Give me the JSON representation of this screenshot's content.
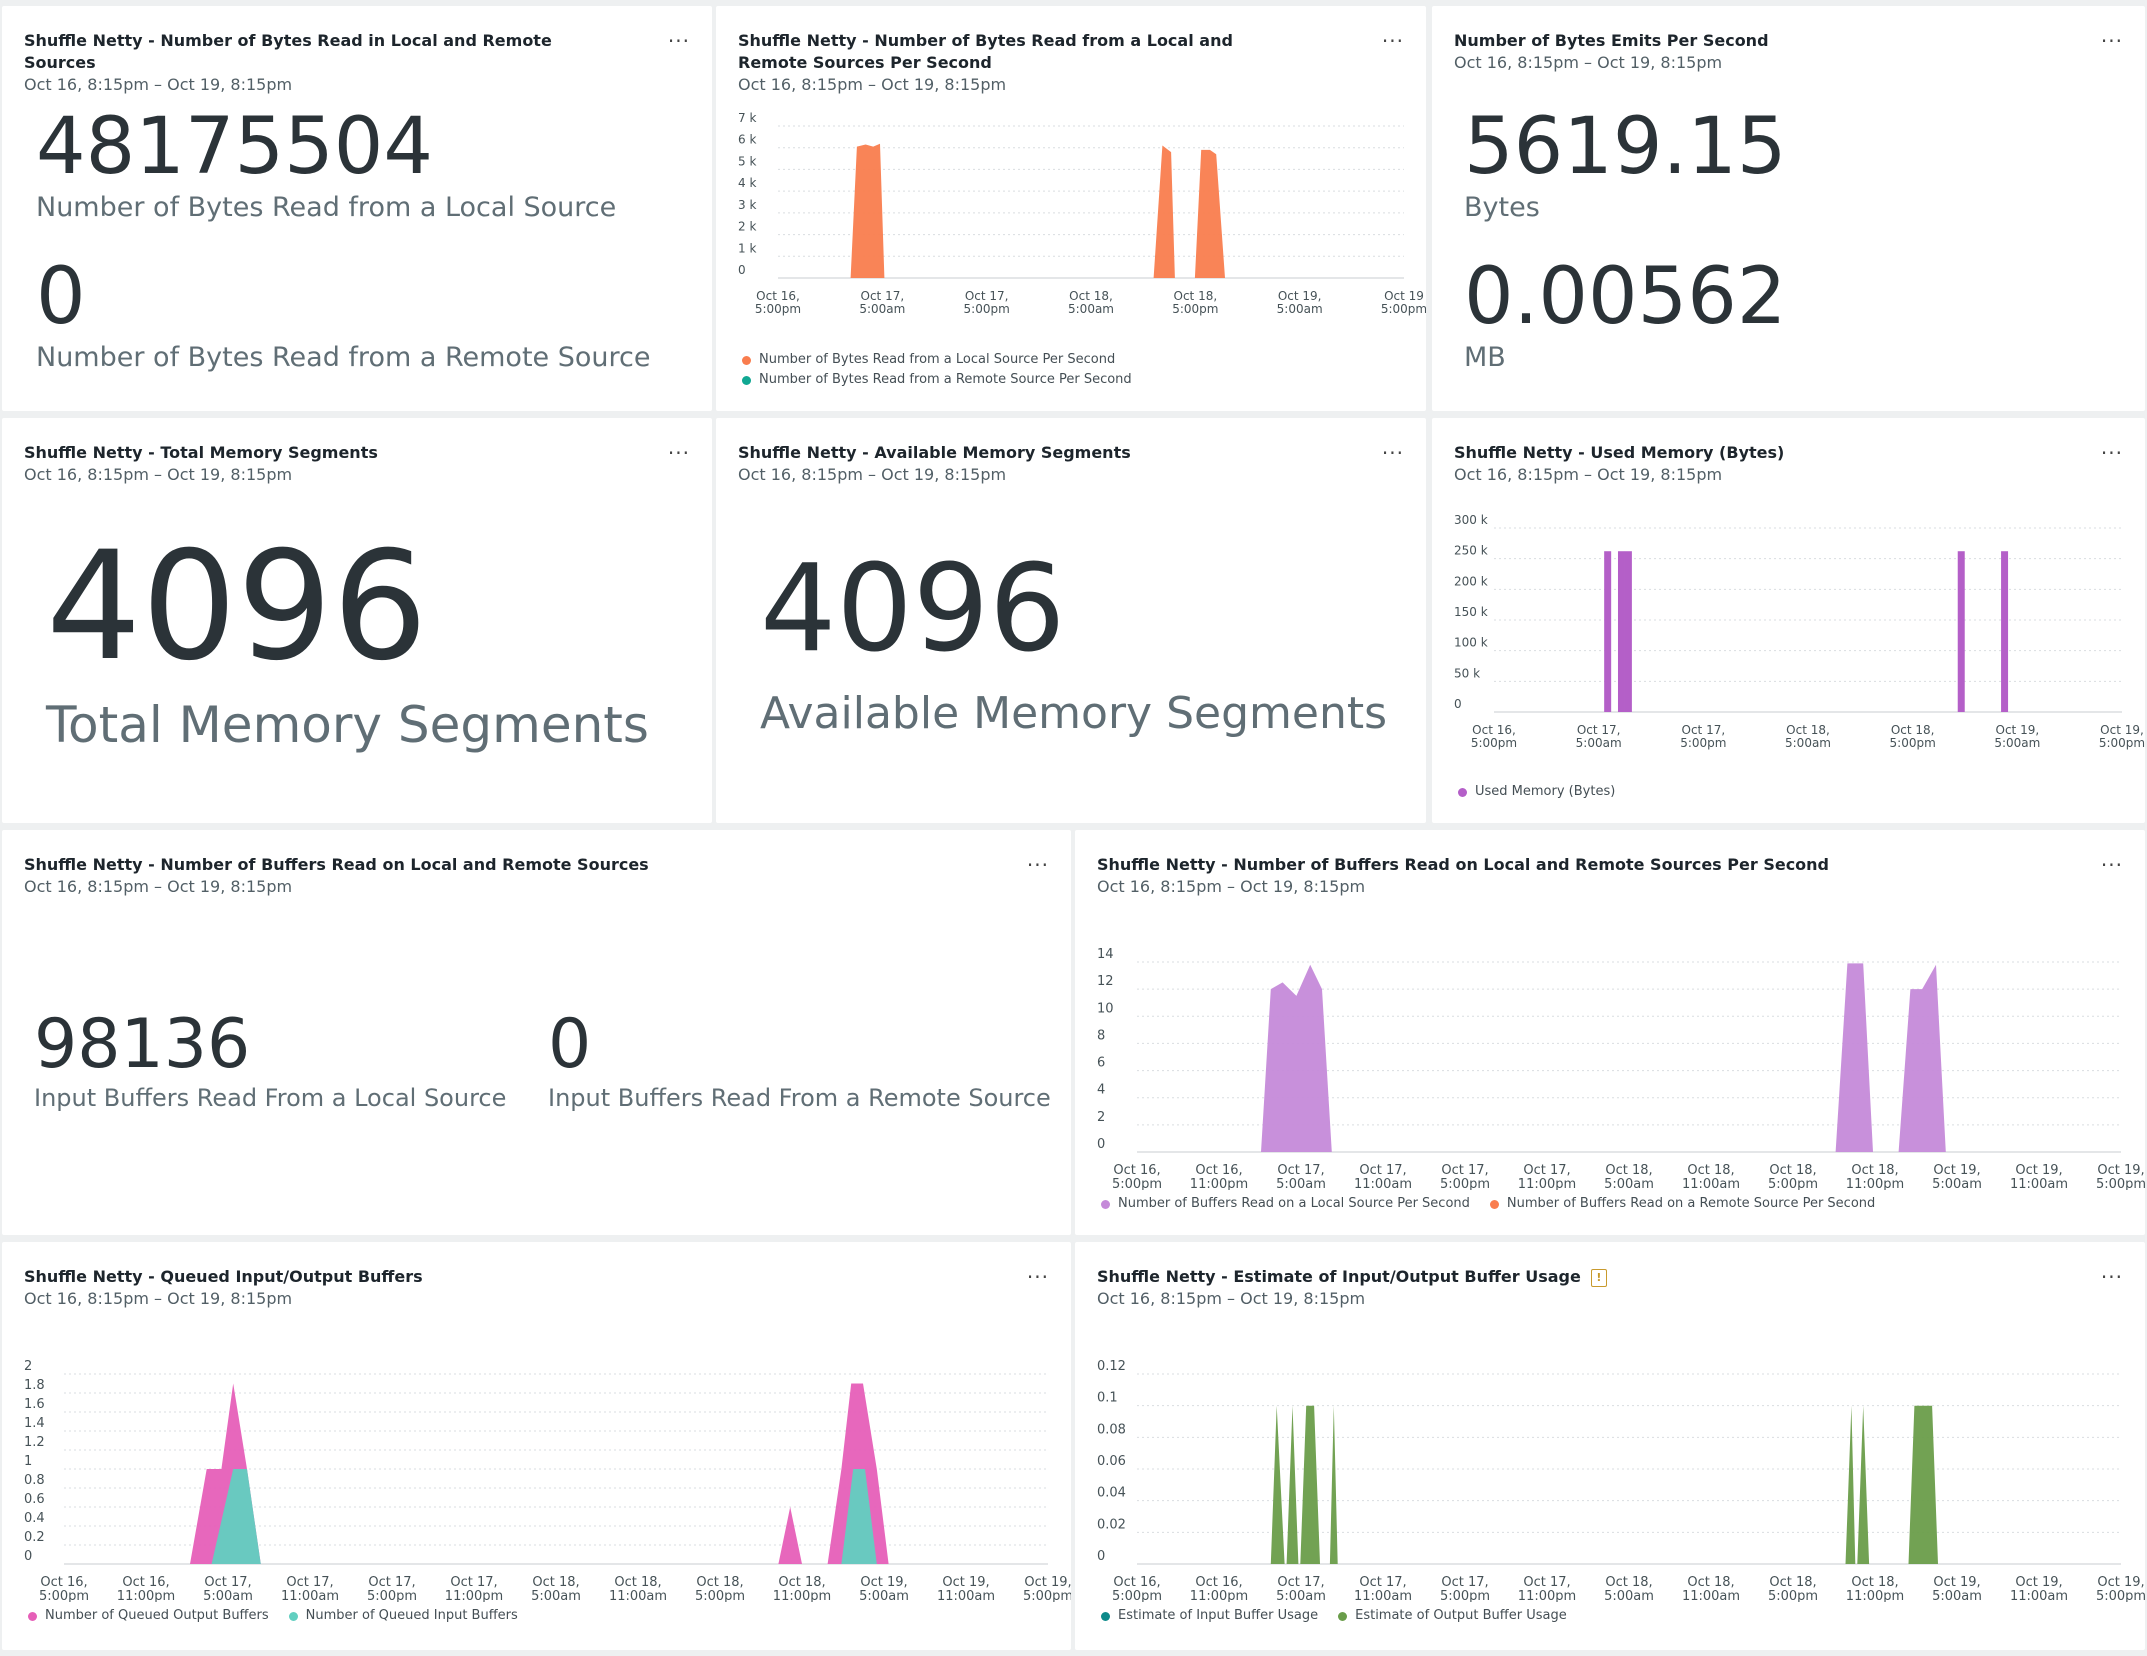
{
  "time_range": "Oct 16, 8:15pm – Oct 19, 8:15pm",
  "menu_label": "...",
  "p1": {
    "title": "Shuffle Netty - Number of Bytes Read in Local and Remote Sources",
    "value1": "48175504",
    "label1": "Number of Bytes Read from a Local Source",
    "value2": "0",
    "label2": "Number of Bytes Read from a Remote Source"
  },
  "p2": {
    "title": "Shuffle Netty - Number of Bytes Read from a Local and Remote Sources Per Second"
  },
  "p3": {
    "title": "Number of Bytes Emits Per Second",
    "value1": "5619.15",
    "label1": "Bytes",
    "value2": "0.00562",
    "label2": "MB"
  },
  "p4": {
    "title": "Shuffle Netty - Total Memory Segments",
    "value": "4096",
    "label": "Total Memory Segments"
  },
  "p5": {
    "title": "Shuffle Netty - Available Memory Segments",
    "value": "4096",
    "label": "Available Memory Segments"
  },
  "p6": {
    "title": "Shuffle Netty - Used Memory (Bytes)"
  },
  "p7": {
    "title": "Shuffle Netty - Number of Buffers Read on Local and Remote Sources",
    "value1": "98136",
    "label1": "Input Buffers Read From a Local Source",
    "value2": "0",
    "label2": "Input Buffers Read From a Remote Source"
  },
  "p8": {
    "title": "Shuffle Netty - Number of Buffers Read on Local and Remote Sources Per Second"
  },
  "p9": {
    "title": "Shuffle Netty - Queued Input/Output Buffers"
  },
  "p10": {
    "title": "Shuffle Netty - Estimate of Input/Output Buffer Usage",
    "warning_glyph": "!"
  },
  "chart_data": [
    {
      "id": "bytes-per-second",
      "type": "area",
      "x": [
        0,
        0.08,
        0.085,
        0.095,
        0.105,
        0.115,
        0.12,
        0.624,
        0.63,
        0.642,
        0.656,
        0.664,
        0.672,
        0.678,
        0.704
      ],
      "y_ticks": [
        "0",
        "1 k",
        "2 k",
        "3 k",
        "4 k",
        "5 k",
        "6 k",
        "7 k"
      ],
      "ylim": [
        0,
        7000
      ],
      "x_tick_labels": [
        [
          "Oct 16,",
          "5:00pm"
        ],
        [
          "Oct 17,",
          "5:00am"
        ],
        [
          "Oct 17,",
          "5:00pm"
        ],
        [
          "Oct 18,",
          "5:00am"
        ],
        [
          "Oct 18,",
          "5:00pm"
        ],
        [
          "Oct 19,",
          "5:00am"
        ],
        [
          "Oct 19",
          "5:00pm"
        ]
      ],
      "series": [
        {
          "name": "Number of Bytes Read from a Local Source Per Second",
          "color": "#f97d4e",
          "points": [
            [
              0.116,
              0
            ],
            [
              0.126,
              6050
            ],
            [
              0.14,
              6150
            ],
            [
              0.152,
              6050
            ],
            [
              0.163,
              6180
            ],
            [
              0.17,
              0
            ],
            [
              0.6,
              0
            ],
            [
              0.614,
              6100
            ],
            [
              0.628,
              5800
            ],
            [
              0.634,
              0
            ],
            [
              0.666,
              0
            ],
            [
              0.676,
              5900
            ],
            [
              0.69,
              5900
            ],
            [
              0.7,
              5700
            ],
            [
              0.714,
              0
            ]
          ]
        },
        {
          "name": "Number of Bytes Read from a Remote Source Per Second",
          "color": "#11a893",
          "points": []
        }
      ]
    },
    {
      "id": "used-memory",
      "type": "bar",
      "y_ticks": [
        "0",
        "50 k",
        "100 k",
        "150 k",
        "200 k",
        "250 k",
        "300 k"
      ],
      "ylim": [
        0,
        300000
      ],
      "x_tick_labels": [
        [
          "Oct 16,",
          "5:00pm"
        ],
        [
          "Oct 17,",
          "5:00am"
        ],
        [
          "Oct 17,",
          "5:00pm"
        ],
        [
          "Oct 18,",
          "5:00am"
        ],
        [
          "Oct 18,",
          "5:00pm"
        ],
        [
          "Oct 19,",
          "5:00am"
        ],
        [
          "Oct 19,",
          "5:00pm"
        ]
      ],
      "series": [
        {
          "name": "Used Memory (Bytes)",
          "color": "#b45fc8",
          "bars": [
            [
              0.181,
              262144
            ],
            [
              0.203,
              262144
            ],
            [
              0.214,
              262144
            ],
            [
              0.744,
              262144
            ],
            [
              0.813,
              262144
            ]
          ]
        }
      ]
    },
    {
      "id": "buffers-per-second",
      "type": "area",
      "y_ticks": [
        "0",
        "2",
        "4",
        "6",
        "8",
        "10",
        "12",
        "14"
      ],
      "ylim": [
        0,
        14
      ],
      "x_tick_labels": [
        [
          "Oct 16,",
          "5:00pm"
        ],
        [
          "Oct 16,",
          "11:00pm"
        ],
        [
          "Oct 17,",
          "5:00am"
        ],
        [
          "Oct 17,",
          "11:00am"
        ],
        [
          "Oct 17,",
          "5:00pm"
        ],
        [
          "Oct 17,",
          "11:00pm"
        ],
        [
          "Oct 18,",
          "5:00am"
        ],
        [
          "Oct 18,",
          "11:00am"
        ],
        [
          "Oct 18,",
          "5:00pm"
        ],
        [
          "Oct 18,",
          "11:00pm"
        ],
        [
          "Oct 19,",
          "5:00am"
        ],
        [
          "Oct 19,",
          "11:00am"
        ],
        [
          "Oct 19,",
          "5:00pm"
        ]
      ],
      "series": [
        {
          "name": "Number of Buffers Read on a Local Source Per Second",
          "color": "#c58ad9",
          "points": [
            [
              0.126,
              0
            ],
            [
              0.136,
              12.0
            ],
            [
              0.148,
              12.5
            ],
            [
              0.162,
              11.5
            ],
            [
              0.176,
              13.8
            ],
            [
              0.188,
              12.0
            ],
            [
              0.198,
              0
            ],
            [
              0.71,
              0
            ],
            [
              0.722,
              13.9
            ],
            [
              0.738,
              13.9
            ],
            [
              0.748,
              0
            ],
            [
              0.774,
              0
            ],
            [
              0.786,
              12.0
            ],
            [
              0.798,
              12.0
            ],
            [
              0.812,
              13.8
            ],
            [
              0.822,
              0
            ]
          ]
        },
        {
          "name": "Number of Buffers Read on a Remote Source Per Second",
          "color": "#f97d4e",
          "points": []
        }
      ]
    },
    {
      "id": "queued-buffers",
      "type": "area",
      "y_ticks": [
        "0",
        "0.2",
        "0.4",
        "0.6",
        "0.8",
        "1",
        "1.2",
        "1.4",
        "1.6",
        "1.8",
        "2"
      ],
      "ylim": [
        0,
        2
      ],
      "x_tick_labels": [
        [
          "Oct 16,",
          "5:00pm"
        ],
        [
          "Oct 16,",
          "11:00pm"
        ],
        [
          "Oct 17,",
          "5:00am"
        ],
        [
          "Oct 17,",
          "11:00am"
        ],
        [
          "Oct 17,",
          "5:00pm"
        ],
        [
          "Oct 17,",
          "11:00pm"
        ],
        [
          "Oct 18,",
          "5:00am"
        ],
        [
          "Oct 18,",
          "11:00am"
        ],
        [
          "Oct 18,",
          "5:00pm"
        ],
        [
          "Oct 18,",
          "11:00pm"
        ],
        [
          "Oct 19,",
          "5:00am"
        ],
        [
          "Oct 19,",
          "11:00am"
        ],
        [
          "Oct 19,",
          "5:00pm"
        ]
      ],
      "series": [
        {
          "name": "Number of Queued Output Buffers",
          "color": "#e65fb8",
          "points": [
            [
              0.128,
              0
            ],
            [
              0.145,
              1.0
            ],
            [
              0.16,
              1.0
            ],
            [
              0.172,
              1.9
            ],
            [
              0.186,
              1.0
            ],
            [
              0.2,
              0
            ],
            [
              0.726,
              0
            ],
            [
              0.738,
              0.6
            ],
            [
              0.75,
              0
            ],
            [
              0.776,
              0
            ],
            [
              0.79,
              1.0
            ],
            [
              0.8,
              1.9
            ],
            [
              0.812,
              1.9
            ],
            [
              0.826,
              1.0
            ],
            [
              0.838,
              0
            ]
          ]
        },
        {
          "name": "Number of Queued Input Buffers",
          "color": "#62cfc0",
          "points": [
            [
              0.15,
              0
            ],
            [
              0.172,
              1.0
            ],
            [
              0.186,
              1.0
            ],
            [
              0.2,
              0
            ],
            [
              0.79,
              0
            ],
            [
              0.802,
              1.0
            ],
            [
              0.814,
              1.0
            ],
            [
              0.826,
              0
            ]
          ]
        }
      ]
    },
    {
      "id": "buffer-usage",
      "type": "area",
      "y_ticks": [
        "0",
        "0.02",
        "0.04",
        "0.06",
        "0.08",
        "0.1",
        "0.12"
      ],
      "ylim": [
        0,
        0.12
      ],
      "x_tick_labels": [
        [
          "Oct 16,",
          "5:00pm"
        ],
        [
          "Oct 16,",
          "11:00pm"
        ],
        [
          "Oct 17,",
          "5:00am"
        ],
        [
          "Oct 17,",
          "11:00am"
        ],
        [
          "Oct 17,",
          "5:00pm"
        ],
        [
          "Oct 17,",
          "11:00pm"
        ],
        [
          "Oct 18,",
          "5:00am"
        ],
        [
          "Oct 18,",
          "11:00am"
        ],
        [
          "Oct 18,",
          "5:00pm"
        ],
        [
          "Oct 18,",
          "11:00pm"
        ],
        [
          "Oct 19,",
          "5:00am"
        ],
        [
          "Oct 19,",
          "11:00am"
        ],
        [
          "Oct 19,",
          "5:00pm"
        ]
      ],
      "series": [
        {
          "name": "Estimate of Input Buffer Usage",
          "color": "#0d8a8a",
          "points": []
        },
        {
          "name": "Estimate of Output Buffer Usage",
          "color": "#6a9d4a",
          "points": [
            [
              0.136,
              0
            ],
            [
              0.142,
              0.1
            ],
            [
              0.15,
              0
            ],
            [
              0.152,
              0
            ],
            [
              0.158,
              0.1
            ],
            [
              0.164,
              0
            ],
            [
              0.166,
              0
            ],
            [
              0.172,
              0.1
            ],
            [
              0.18,
              0.1
            ],
            [
              0.186,
              0
            ],
            [
              0.196,
              0
            ],
            [
              0.2,
              0.1
            ],
            [
              0.204,
              0
            ],
            [
              0.72,
              0
            ],
            [
              0.726,
              0.1
            ],
            [
              0.73,
              0
            ],
            [
              0.732,
              0
            ],
            [
              0.738,
              0.1
            ],
            [
              0.744,
              0
            ],
            [
              0.784,
              0
            ],
            [
              0.79,
              0.1
            ],
            [
              0.808,
              0.1
            ],
            [
              0.814,
              0
            ]
          ]
        }
      ]
    }
  ]
}
